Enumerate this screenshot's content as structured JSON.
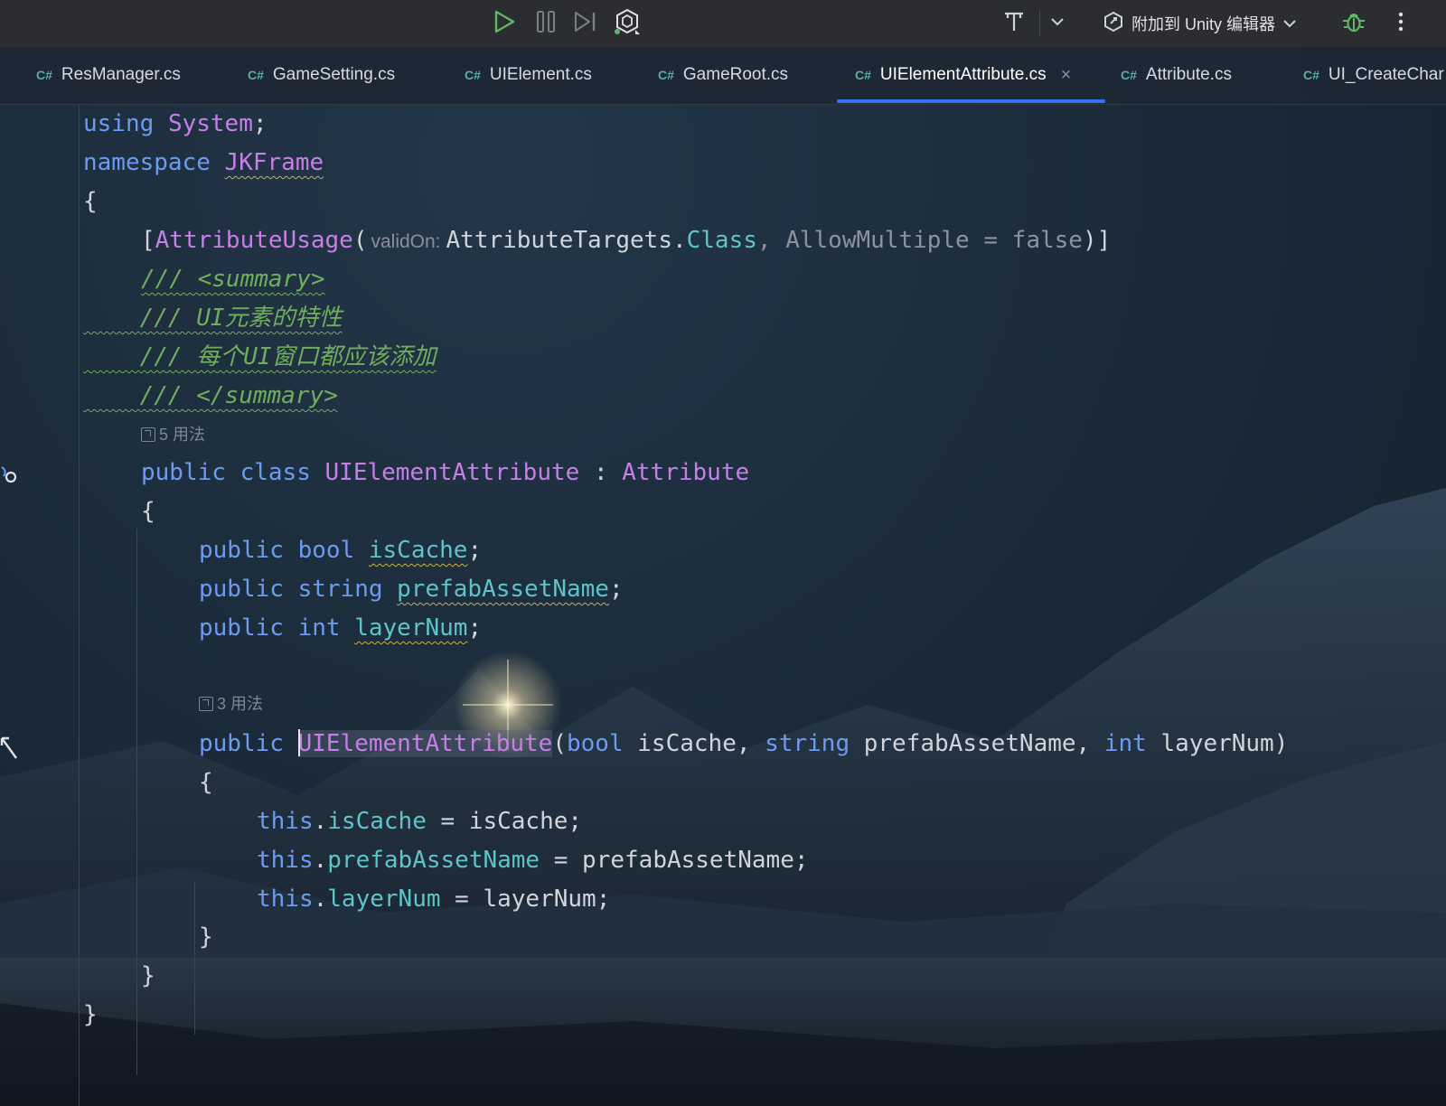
{
  "toolbar": {
    "attach_label": "附加到 Unity 编辑器"
  },
  "tabs": [
    {
      "label": "ResManager.cs",
      "lang": "C#"
    },
    {
      "label": "GameSetting.cs",
      "lang": "C#"
    },
    {
      "label": "UIElement.cs",
      "lang": "C#"
    },
    {
      "label": "GameRoot.cs",
      "lang": "C#"
    },
    {
      "label": "UIElementAttribute.cs",
      "lang": "C#",
      "active": true
    },
    {
      "label": "Attribute.cs",
      "lang": "C#"
    },
    {
      "label": "UI_CreateChar",
      "lang": "C#"
    }
  ],
  "editor": {
    "usages_class": "5 用法",
    "usages_ctor": "3 用法",
    "code": {
      "l1": {
        "kw": "using",
        "ns": "System",
        "end": ";"
      },
      "l2": {
        "kw": "namespace",
        "name": "JKFrame"
      },
      "l3": "{",
      "l4": {
        "open": "[",
        "attr": "AttributeUsage",
        "paren": "(",
        "hint": "validOn:",
        "targets": "AttributeTargets",
        "dot": ".",
        "cls": "Class",
        "rest": ", AllowMultiple = false",
        "close": ")]"
      },
      "l5": "/// <summary>",
      "l6": "/// UI元素的特性",
      "l7": "/// 每个UI窗口都应该添加",
      "l8": "/// </summary>",
      "l9": {
        "kw1": "public",
        "kw2": "class",
        "name": "UIElementAttribute",
        "colon": ":",
        "base": "Attribute"
      },
      "l10": "{",
      "l11": {
        "kw": "public",
        "type": "bool",
        "name": "isCache",
        "end": ";"
      },
      "l12": {
        "kw": "public",
        "type": "string",
        "name": "prefabAssetName",
        "end": ";"
      },
      "l13": {
        "kw": "public",
        "type": "int",
        "name": "layerNum",
        "end": ";"
      },
      "l14": {
        "kw": "public",
        "name": "UIElementAttribute",
        "p_open": "(",
        "t1": "bool",
        "a1": "isCache,",
        "t2": "string",
        "a2": "prefabAssetName,",
        "t3": "int",
        "a3": "layerNum",
        "p_close": ")"
      },
      "l15": "{",
      "l16": {
        "this": "this",
        "dot": ".",
        "field": "isCache",
        "rest": " = isCache;"
      },
      "l17": {
        "this": "this",
        "dot": ".",
        "field": "prefabAssetName",
        "rest": " = prefabAssetName;"
      },
      "l18": {
        "this": "this",
        "dot": ".",
        "field": "layerNum",
        "rest": " = layerNum;"
      },
      "l19": "}",
      "l20": "}",
      "l21": "}"
    }
  },
  "colors": {
    "keyword": "#6c9bf0",
    "type": "#c77ee6",
    "field": "#5ec4c9",
    "comment": "#6fae5c",
    "tab_underline": "#3574f0",
    "toolbar_bg": "#2b2d30"
  },
  "icons": [
    "run-icon",
    "pause-icon",
    "step-icon",
    "unity-icon",
    "format-icon",
    "chevron-down-icon",
    "attach-icon",
    "debug-icon",
    "more-icon"
  ]
}
